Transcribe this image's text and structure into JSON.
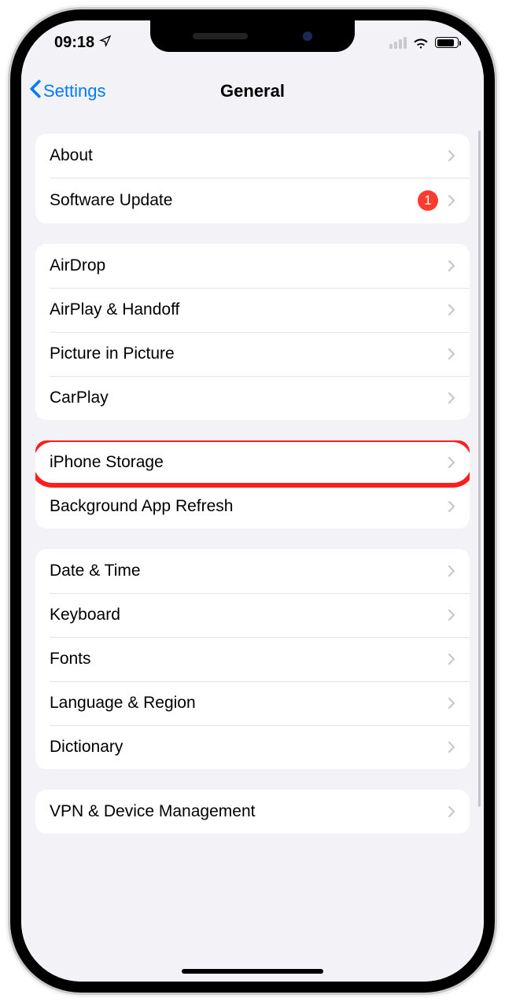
{
  "statusbar": {
    "time": "09:18"
  },
  "nav": {
    "back_label": "Settings",
    "title": "General"
  },
  "groups": [
    {
      "rows": [
        {
          "label": "About",
          "badge": null
        },
        {
          "label": "Software Update",
          "badge": "1"
        }
      ]
    },
    {
      "rows": [
        {
          "label": "AirDrop",
          "badge": null
        },
        {
          "label": "AirPlay & Handoff",
          "badge": null
        },
        {
          "label": "Picture in Picture",
          "badge": null
        },
        {
          "label": "CarPlay",
          "badge": null
        }
      ]
    },
    {
      "rows": [
        {
          "label": "iPhone Storage",
          "badge": null,
          "highlighted": true
        },
        {
          "label": "Background App Refresh",
          "badge": null
        }
      ]
    },
    {
      "rows": [
        {
          "label": "Date & Time",
          "badge": null
        },
        {
          "label": "Keyboard",
          "badge": null
        },
        {
          "label": "Fonts",
          "badge": null
        },
        {
          "label": "Language & Region",
          "badge": null
        },
        {
          "label": "Dictionary",
          "badge": null
        }
      ]
    },
    {
      "rows": [
        {
          "label": "VPN & Device Management",
          "badge": null
        }
      ]
    }
  ]
}
